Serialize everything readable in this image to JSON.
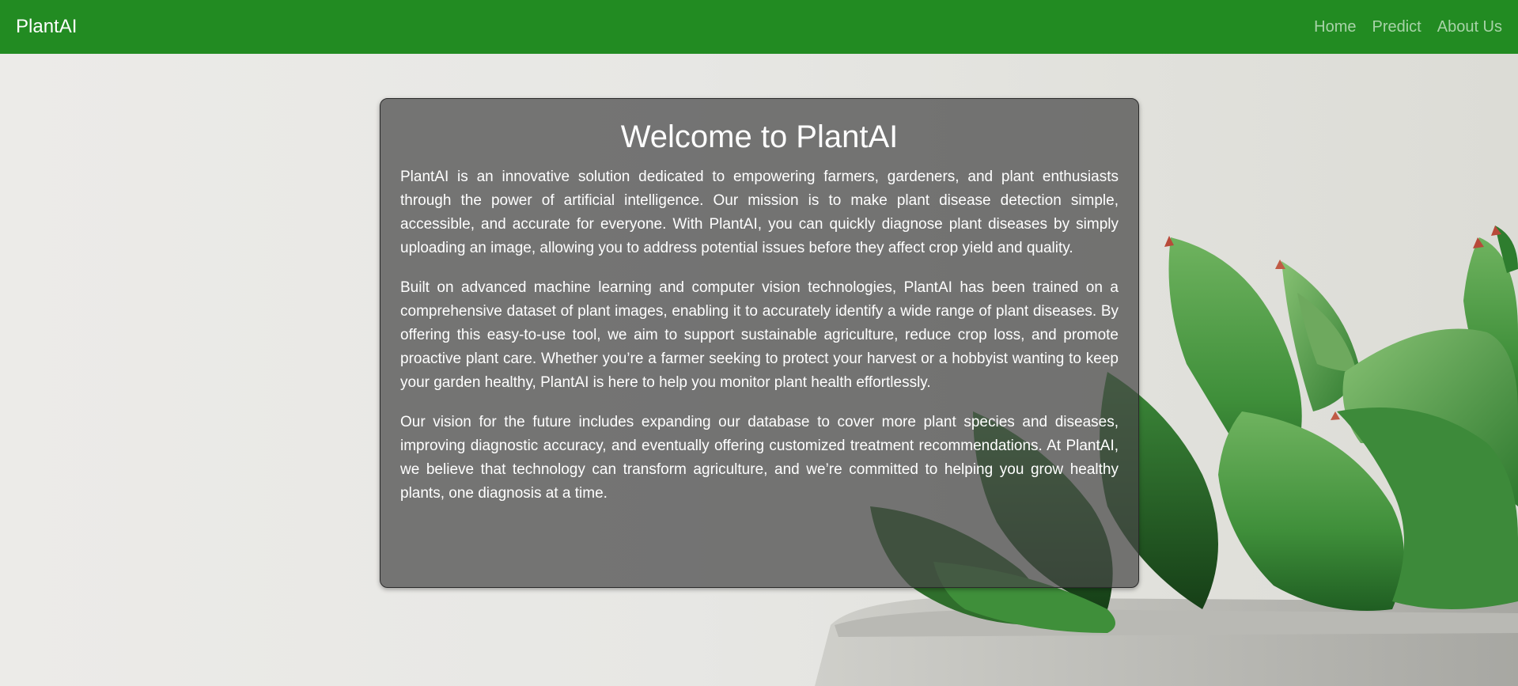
{
  "navbar": {
    "brand": "PlantAI",
    "links": [
      "Home",
      "Predict",
      "About Us"
    ],
    "background_color": "#228b22"
  },
  "hero": {
    "title": "Welcome to PlantAI",
    "paragraphs": [
      "PlantAI is an innovative solution dedicated to empowering farmers, gardeners, and plant enthusiasts through the power of artificial intelligence. Our mission is to make plant disease detection simple, accessible, and accurate for everyone. With PlantAI, you can quickly diagnose plant diseases by simply uploading an image, allowing you to address potential issues before they affect crop yield and quality.",
      "Built on advanced machine learning and computer vision technologies, PlantAI has been trained on a comprehensive dataset of plant images, enabling it to accurately identify a wide range of plant diseases. By offering this easy-to-use tool, we aim to support sustainable agriculture, reduce crop loss, and promote proactive plant care. Whether you’re a farmer seeking to protect your harvest or a hobbyist wanting to keep your garden healthy, PlantAI is here to help you monitor plant health effortlessly.",
      "Our vision for the future includes expanding our database to cover more plant species and diseases, improving diagnostic accuracy, and eventually offering customized treatment recommendations. At PlantAI, we believe that technology can transform agriculture, and we’re committed to helping you grow healthy plants, one diagnosis at a time."
    ]
  },
  "background": {
    "image": "succulent-plant-in-concrete-pot",
    "plant_color": "#3f8f3a",
    "pot_color": "#bdbdb8"
  }
}
